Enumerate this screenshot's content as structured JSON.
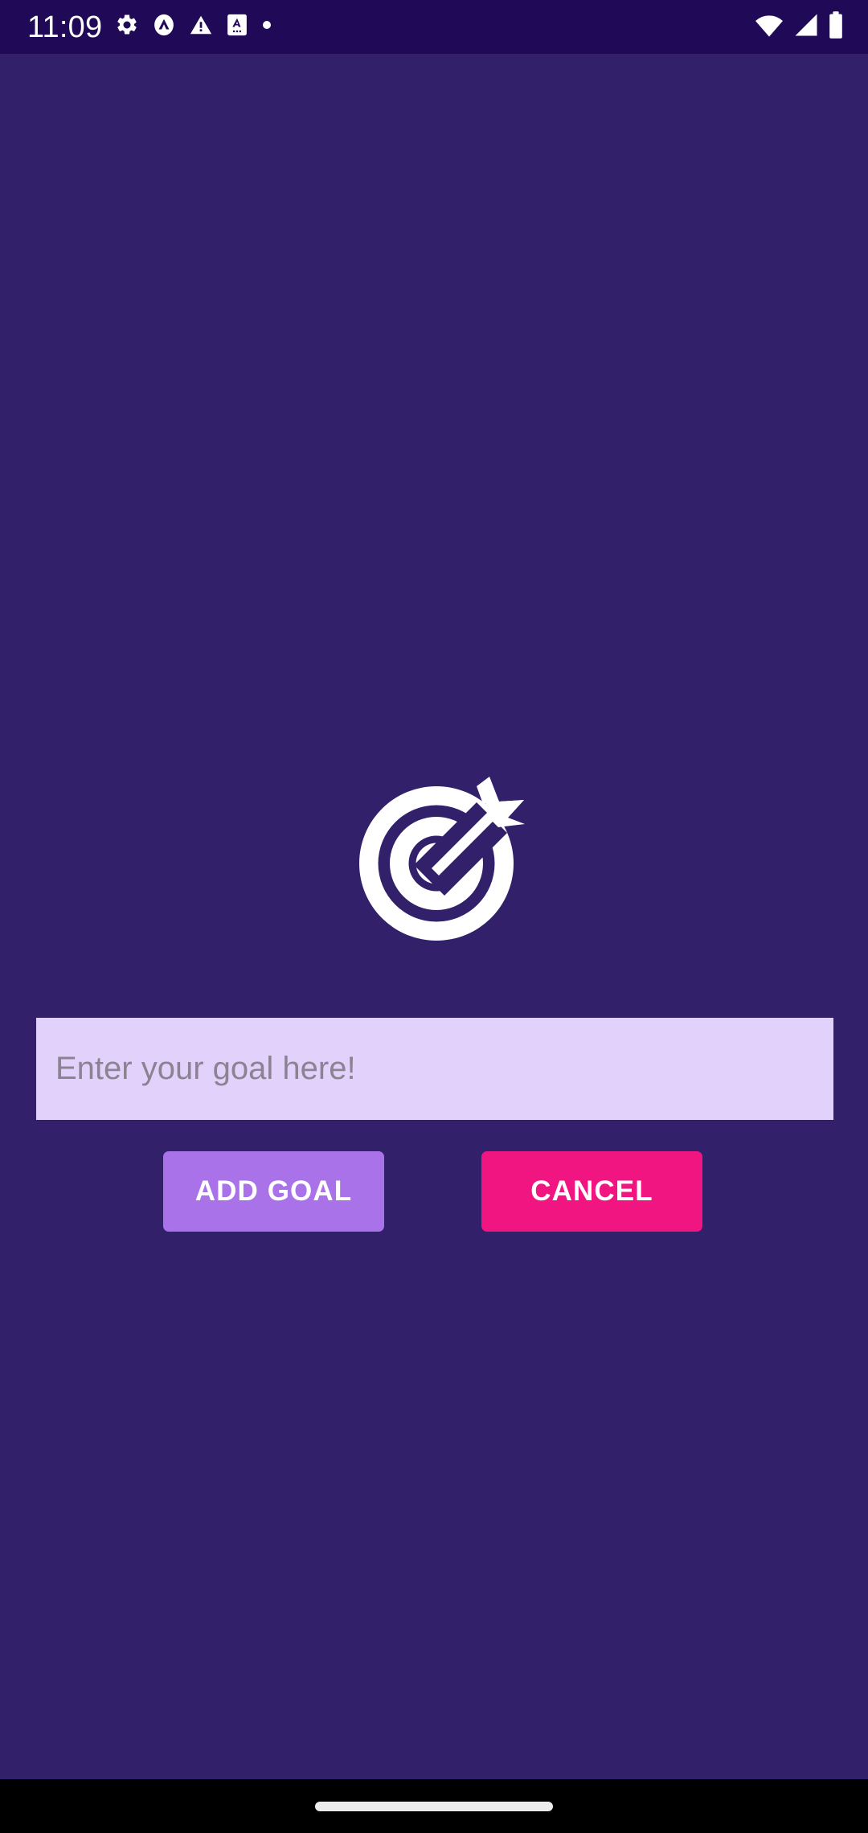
{
  "status_bar": {
    "clock": "11:09",
    "background_color": "#200a57",
    "left_icons": [
      {
        "name": "gear-icon",
        "glyph": "settings"
      },
      {
        "name": "vpn-circle-icon",
        "glyph": "caret-in-circle"
      },
      {
        "name": "warning-triangle-icon",
        "glyph": "warning"
      },
      {
        "name": "screenshot-a-icon",
        "glyph": "letter-a-box"
      },
      {
        "name": "dot-icon",
        "glyph": "dot"
      }
    ],
    "right_icons": [
      {
        "name": "wifi-icon",
        "glyph": "wifi"
      },
      {
        "name": "cellular-signal-icon",
        "glyph": "signal"
      },
      {
        "name": "battery-icon",
        "glyph": "battery-full"
      }
    ]
  },
  "screen": {
    "background_color": "#32206b",
    "hero_icon": {
      "name": "target-bullseye-arrow-icon",
      "color": "#ffffff"
    }
  },
  "goal_input": {
    "value": "",
    "placeholder": "Enter your goal here!",
    "background_color": "#e2d2fb",
    "placeholder_color": "#8d8291"
  },
  "buttons": {
    "add_goal": {
      "label": "ADD GOAL",
      "background_color": "#a972e8",
      "text_color": "#ffffff"
    },
    "cancel": {
      "label": "CANCEL",
      "background_color": "#f01580",
      "text_color": "#ffffff"
    }
  },
  "navigation_bar": {
    "background_color": "#000000",
    "home_indicator_color": "#ececec"
  }
}
